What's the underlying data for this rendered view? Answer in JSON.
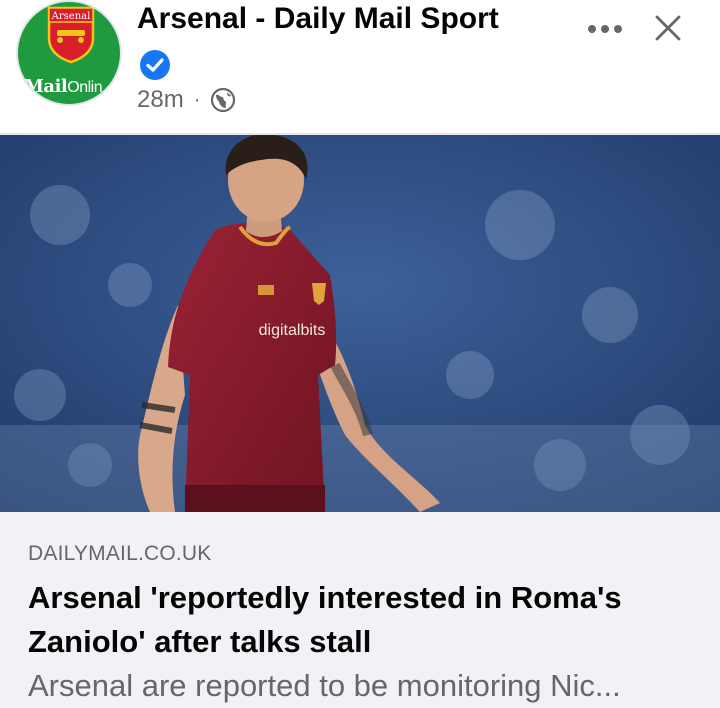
{
  "post": {
    "page_name": "Arsenal - Daily Mail Sport",
    "timestamp": "28m",
    "separator": "·",
    "audience_icon": "globe-icon",
    "verified_icon": "verified-badge-icon",
    "avatar": {
      "crest_text": "Arsenal",
      "brand_text": "MailOnline",
      "brand_bold": "Mail",
      "brand_light": "Onlin",
      "color": "#1f9a3f"
    }
  },
  "actions": {
    "more_icon": "more-options-icon",
    "close_icon": "close-icon"
  },
  "photo": {
    "sponsor_text": "digitalbits"
  },
  "link_preview": {
    "domain": "DAILYMAIL.CO.UK",
    "headline": "Arsenal 'reportedly interested in Roma's Zaniolo' after talks stall",
    "summary": "Arsenal are reported to be monitoring Nic..."
  },
  "colors": {
    "verified_blue": "#1877f2",
    "secondary_text": "#65676b",
    "preview_bg": "#f0f2f5",
    "kit_red": "#8e1b2c"
  }
}
